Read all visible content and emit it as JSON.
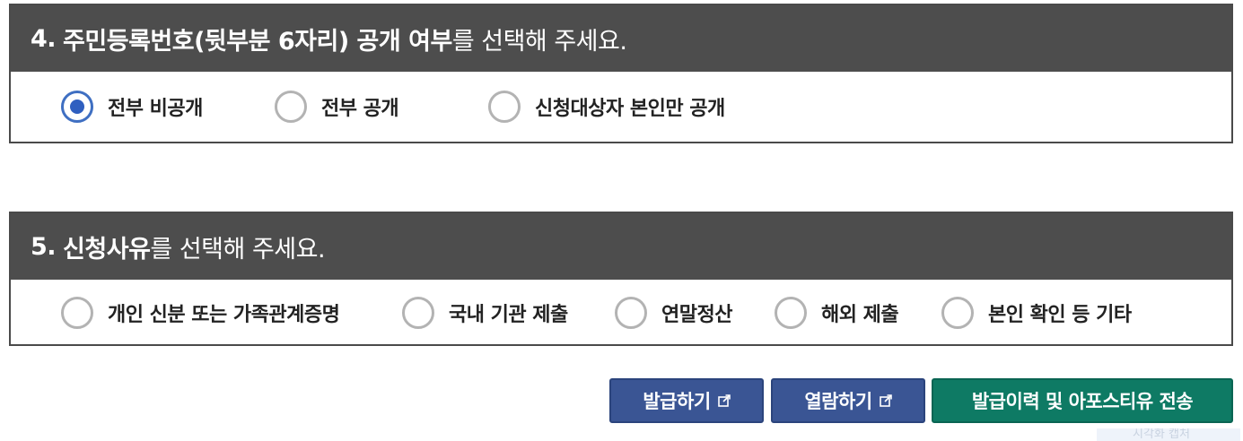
{
  "section4": {
    "number": "4.",
    "title_bold": "주민등록번호(뒷부분 6자리) 공개 여부",
    "title_rest": "를 선택해 주세요.",
    "options": [
      {
        "label": "전부 비공개",
        "checked": true
      },
      {
        "label": "전부 공개",
        "checked": false
      },
      {
        "label": "신청대상자 본인만 공개",
        "checked": false
      }
    ]
  },
  "section5": {
    "number": "5.",
    "title_bold": "신청사유",
    "title_rest": "를 선택해 주세요.",
    "options": [
      {
        "label": "개인 신분 또는 가족관계증명",
        "checked": false
      },
      {
        "label": "국내 기관 제출",
        "checked": false
      },
      {
        "label": "연말정산",
        "checked": false
      },
      {
        "label": "해외 제출",
        "checked": false
      },
      {
        "label": "본인 확인 등 기타",
        "checked": false
      }
    ]
  },
  "buttons": {
    "issue": "발급하기",
    "view": "열람하기",
    "send": "발급이력 및 아포스티유 전송"
  },
  "icons": {
    "external_link": "external-link-icon"
  },
  "colors": {
    "header_bg": "#4d4d4d",
    "radio_checked": "#2f5fc0",
    "btn_blue": "#3a5594",
    "btn_green": "#0e7a64"
  },
  "ghost_text": "시각화 캡처"
}
